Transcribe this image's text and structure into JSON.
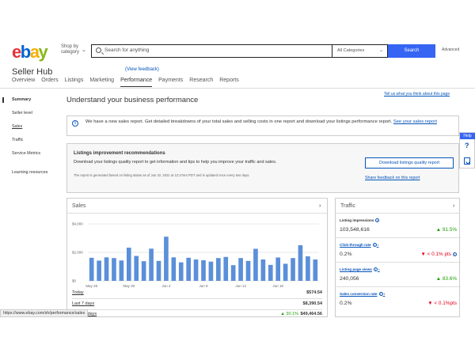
{
  "header": {
    "logo": [
      "e",
      "b",
      "a",
      "y"
    ],
    "shop_by_line1": "Shop by",
    "shop_by_line2": "category",
    "search_placeholder": "Search for anything",
    "category_value": "All Categories",
    "search_button": "Search",
    "advanced": "Advanced"
  },
  "hub": {
    "title": "Seller Hub",
    "feedback_link": "(View feedback)",
    "tabs": [
      "Overview",
      "Orders",
      "Listings",
      "Marketing",
      "Performance",
      "Payments",
      "Research",
      "Reports"
    ]
  },
  "sidebar": {
    "items": [
      "Summary",
      "Seller level",
      "Sales",
      "Traffic",
      "Service Metrics",
      "Learning resources"
    ]
  },
  "main": {
    "title": "Understand your business performance",
    "tell_us": "Tell us what you think about this page",
    "banner_text": "We have a new sales report. Get detailed breakdowns of your total sales and selling costs in one report and download your listings performance report.",
    "banner_link": "See your sales report"
  },
  "lir": {
    "title": "Listings improvement recommendations",
    "desc": "Download your listings quality report to get information and tips to help you improve your traffic and sales.",
    "note": "The report is generated based on listing status as of Jun 22, 2021 at 12:27am PDT and is updated once every two days.",
    "button": "Download listings quality report",
    "share": "Share feedback on this report"
  },
  "sales": {
    "title": "Sales",
    "rows": [
      {
        "label": "Today",
        "value": "$574.54"
      },
      {
        "label": "Last 7 days",
        "value": "$8,390.54"
      },
      {
        "label": "Last 31 days",
        "change": "30.1%",
        "value": "$49,464.56"
      }
    ]
  },
  "chart_data": {
    "type": "bar",
    "title": "",
    "ylim": [
      0,
      4000
    ],
    "yticks": [
      "$4,000",
      "$2,000",
      "$0"
    ],
    "ytick_values": [
      4000,
      2000,
      0
    ],
    "xtick_labels": [
      "May 25",
      "May 30",
      "Jun 4",
      "Jun 9",
      "Jun 14",
      "Jun 19"
    ],
    "xtick_indices": [
      0,
      5,
      10,
      15,
      20,
      25
    ],
    "values": [
      1620,
      1420,
      1650,
      1600,
      1430,
      2330,
      1750,
      1380,
      2260,
      1400,
      3100,
      1650,
      1300,
      1620,
      1500,
      1450,
      1350,
      1600,
      1680,
      1100,
      1600,
      1400,
      2250,
      1500,
      1120,
      1640,
      1200,
      1600,
      2500,
      1720,
      1500
    ],
    "bar_color": "#5b8fd9",
    "grid": true
  },
  "traffic": {
    "title": "Traffic",
    "metrics": [
      {
        "label": "Listing impressions",
        "value": "103,548,616",
        "change": "91.5%"
      },
      {
        "label": "Click-through rate",
        "value": "0.2%",
        "change": "< 0.1% pts"
      },
      {
        "label": "Listing page views",
        "value": "240,056",
        "change": "83.6%"
      },
      {
        "label": "Sales conversion rate",
        "value": "0.2%",
        "change": "< 0.1%pts"
      }
    ]
  },
  "help": {
    "label": "Help"
  },
  "status": {
    "url": "https://www.ebay.com/sh/performance/sales"
  }
}
